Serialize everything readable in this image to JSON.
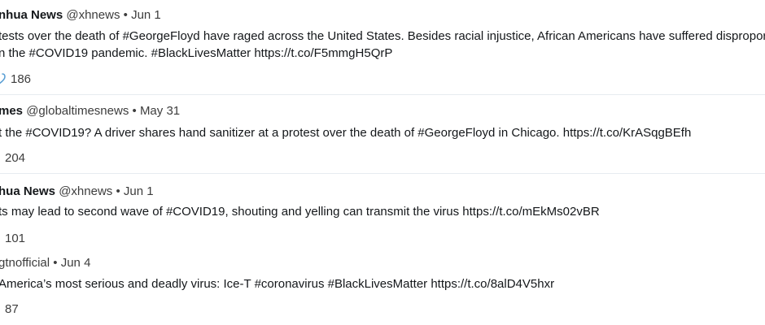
{
  "feed": {
    "tweets": [
      {
        "author": "nhua News",
        "handle": "@xhnews",
        "separator": "•",
        "date": "Jun 1",
        "text_line1": "tests over the death of #GeorgeFloyd have raged across the United States. Besides racial injustice, African Americans have suffered disproport",
        "text_line2": "n the #COVID19 pandemic. #BlackLivesMatter https://t.co/F5mmgH5QrP",
        "likes": "186",
        "heart_icon": "heart-icon"
      },
      {
        "author": "mes",
        "handle": "@globaltimesnews",
        "separator": "•",
        "date": "May 31",
        "text_line1": "t the #COVID19? A driver shares hand sanitizer at a protest over the death of #GeorgeFloyd in Chicago. https://t.co/KrASqgBEfh",
        "likes": "204"
      },
      {
        "author": "hua News",
        "handle": "@xhnews",
        "separator": "•",
        "date": "Jun 1",
        "text_line1": "ts may lead to second wave of #COVID19, shouting and yelling can transmit the virus https://t.co/mEkMs02vBR",
        "likes": "101"
      },
      {
        "handle": "gtnofficial",
        "separator": "•",
        "date": "Jun 4",
        "text_line1": "America’s most serious and deadly virus: Ice-T #coronavirus #BlackLivesMatter https://t.co/8alD4V5hxr",
        "likes": "87"
      }
    ]
  },
  "colors": {
    "text": "#14171a",
    "meta": "#3d3d3d",
    "heart": "#5a9fd4",
    "divider": "#e6ecf0"
  }
}
